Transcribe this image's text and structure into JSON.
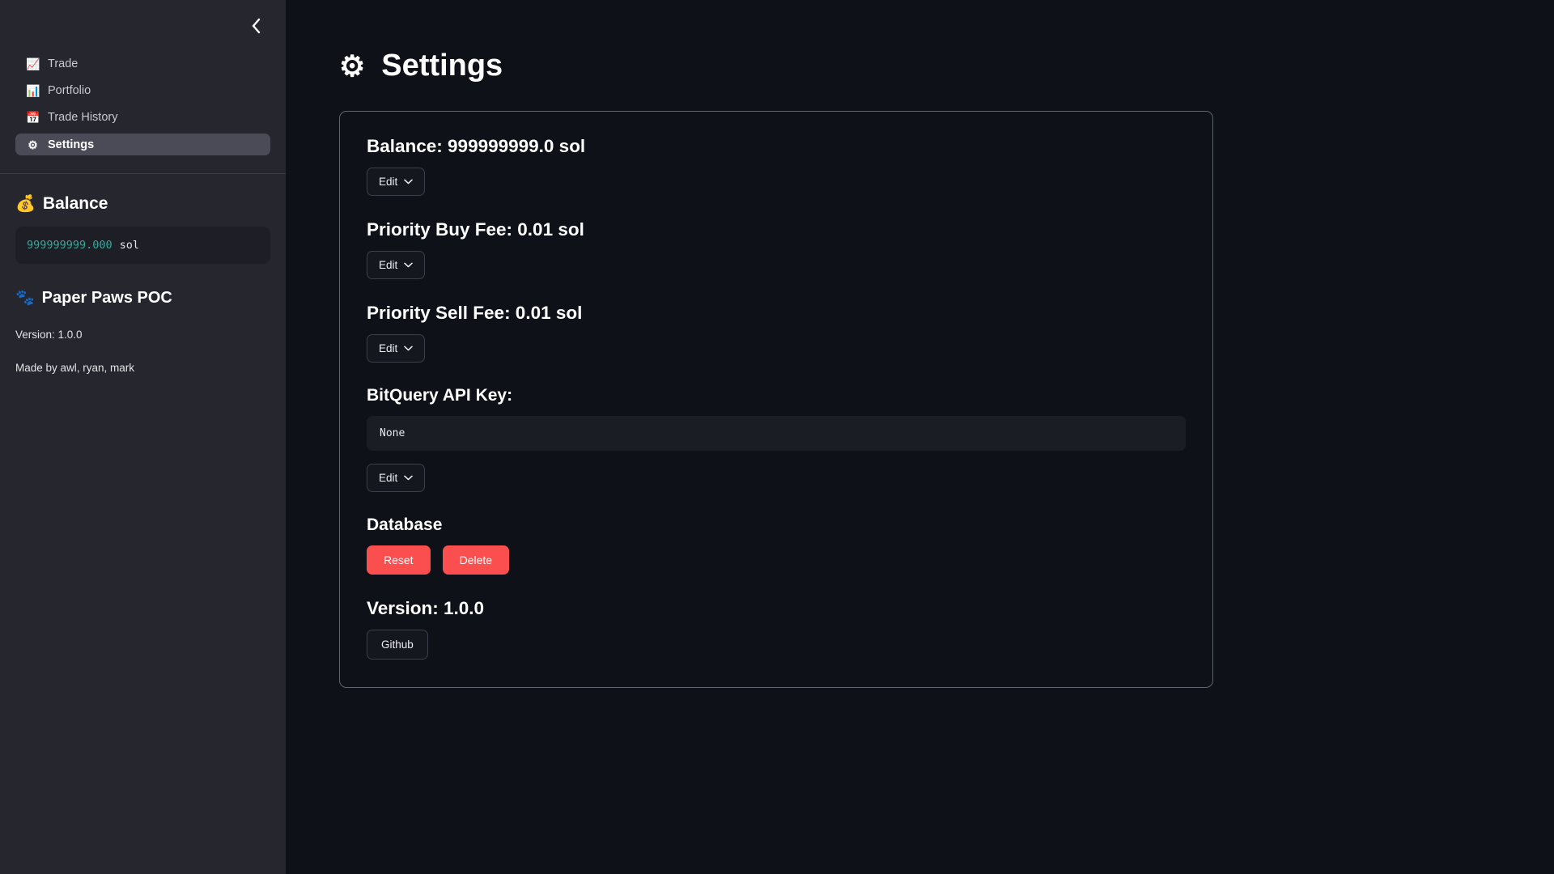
{
  "sidebar": {
    "collapse_icon": "chevron-left-icon",
    "nav": [
      {
        "icon": "📈",
        "icon_name": "chart-increasing-icon",
        "label": "Trade",
        "active": false
      },
      {
        "icon": "📊",
        "icon_name": "bar-chart-icon",
        "label": "Portfolio",
        "active": false
      },
      {
        "icon": "📅",
        "icon_name": "calendar-icon",
        "label": "Trade History",
        "active": false
      },
      {
        "icon": "⚙",
        "icon_name": "gear-icon",
        "label": "Settings",
        "active": true
      }
    ],
    "balance": {
      "icon": "💰",
      "icon_name": "money-bag-icon",
      "heading": "Balance",
      "amount": "999999999.000",
      "unit": "sol"
    },
    "brand": {
      "icon": "🐾",
      "icon_name": "paw-prints-icon",
      "name": "Paper Paws POC",
      "version": "Version: 1.0.0",
      "credits": "Made by awl, ryan, mark"
    }
  },
  "main": {
    "title": "Settings",
    "title_icon": "⚙",
    "sections": {
      "balance": {
        "title": "Balance: 999999999.0 sol",
        "edit_label": "Edit"
      },
      "priority_buy": {
        "title": "Priority Buy Fee: 0.01 sol",
        "edit_label": "Edit"
      },
      "priority_sell": {
        "title": "Priority Sell Fee: 0.01 sol",
        "edit_label": "Edit"
      },
      "api_key": {
        "title": "BitQuery API Key:",
        "value": "None",
        "placeholder": "None",
        "edit_label": "Edit"
      },
      "database": {
        "title": "Database",
        "reset_label": "Reset",
        "delete_label": "Delete"
      },
      "version": {
        "title": "Version: 1.0.0",
        "github_label": "Github"
      }
    }
  },
  "colors": {
    "sidebar_bg": "#26262f",
    "main_bg": "#0e1117",
    "active_item": "#4b4b58",
    "danger": "#fb4f4f",
    "balance_text": "#3aa79a",
    "card_border": "#5e6470"
  }
}
